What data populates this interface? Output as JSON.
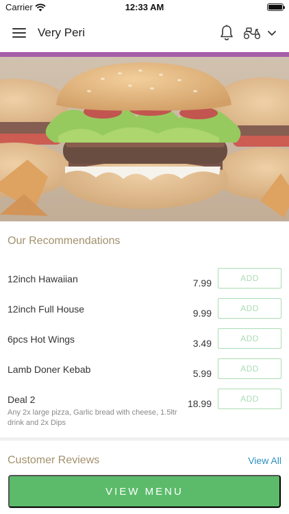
{
  "status_bar": {
    "carrier": "Carrier",
    "time": "12:33 AM",
    "icons": [
      "wifi-icon",
      "battery-icon"
    ]
  },
  "header": {
    "title": "Very Peri",
    "icons": [
      "menu-icon",
      "bell-icon",
      "scooter-icon",
      "chevron-down-icon"
    ],
    "accent_color": "#a55da8"
  },
  "hero": {
    "image": "burger-photo"
  },
  "recommendations": {
    "title": "Our Recommendations",
    "items": [
      {
        "name": "12inch Hawaiian",
        "description": "",
        "price": "7.99",
        "add_label": "ADD"
      },
      {
        "name": "12inch Full House",
        "description": "",
        "price": "9.99",
        "add_label": "ADD"
      },
      {
        "name": "6pcs Hot Wings",
        "description": "",
        "price": "3.49",
        "add_label": "ADD"
      },
      {
        "name": "Lamb Doner Kebab",
        "description": "",
        "price": "5.99",
        "add_label": "ADD"
      },
      {
        "name": "Deal 2",
        "description": "Any 2x large pizza, Garlic bread with cheese, 1.5ltr drink and 2x Dips",
        "price": "18.99",
        "add_label": "ADD"
      }
    ]
  },
  "reviews": {
    "title": "Customer Reviews",
    "view_all_label": "View All"
  },
  "footer": {
    "view_menu_label": "VIEW MENU",
    "button_color": "#5cbb6a"
  },
  "colors": {
    "section_title": "#a2906c",
    "add_button": "#a9dcb3",
    "link": "#2e8fc0"
  }
}
